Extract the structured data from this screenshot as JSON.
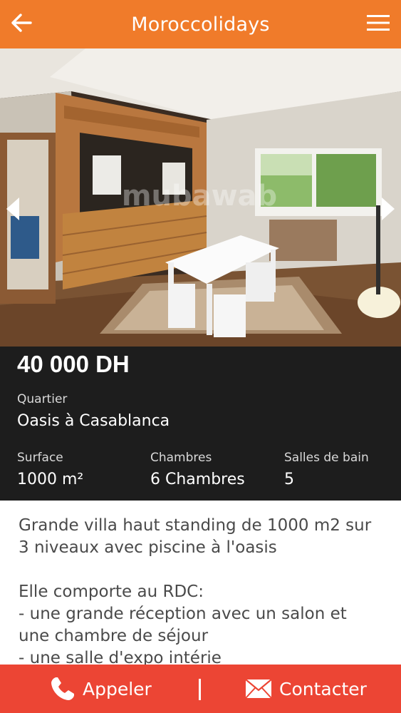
{
  "header": {
    "title": "Moroccolidays",
    "back_icon": "arrow-left-icon",
    "menu_icon": "hamburger-menu-icon"
  },
  "gallery": {
    "watermark": "mubawab",
    "prev_icon": "chevron-left-icon",
    "next_icon": "chevron-right-icon"
  },
  "listing": {
    "price": "40 000 DH",
    "quartier_label": "Quartier",
    "quartier_value": "Oasis à Casablanca",
    "surface_label": "Surface",
    "surface_value": "1000 m²",
    "chambres_label": "Chambres",
    "chambres_value": "6 Chambres",
    "salles_label": "Salles de bain",
    "salles_value": "5"
  },
  "description": {
    "para1_line1": "Grande villa haut standing de 1000 m2 sur",
    "para1_line2": "3 niveaux avec piscine à l'oasis",
    "para2_line1": "Elle comporte au RDC:",
    "para2_line2": "- une grande réception avec un salon et",
    "para2_line3": "une chambre de séjour",
    "para2_line4": "- une salle d'expo intérie"
  },
  "actions": {
    "call_label": "Appeler",
    "call_icon": "phone-icon",
    "contact_label": "Contacter",
    "contact_icon": "envelope-icon"
  },
  "colors": {
    "header": "#f07b2a",
    "info_panel": "#1d1d1d",
    "bottom_bar": "#ec4534"
  }
}
